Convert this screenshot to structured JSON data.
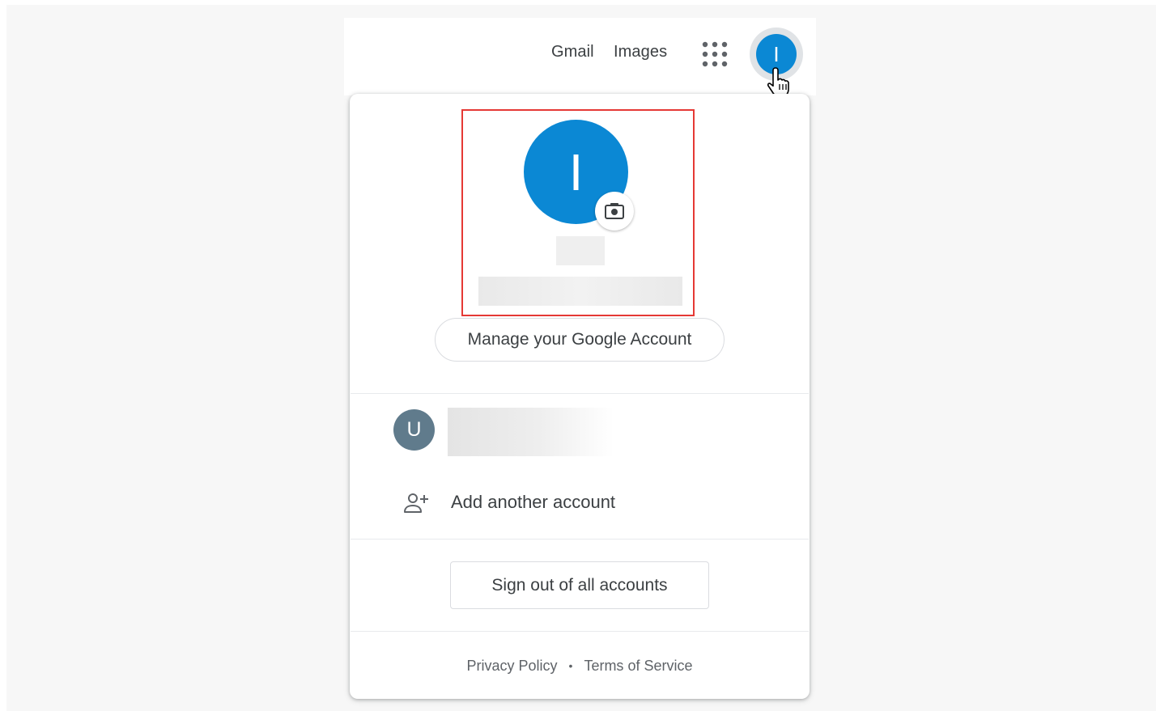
{
  "header": {
    "links": [
      {
        "label": "Gmail"
      },
      {
        "label": "Images"
      }
    ],
    "apps_icon": "apps-grid-icon",
    "avatar_initial": "I"
  },
  "account_panel": {
    "profile": {
      "avatar_initial": "I",
      "avatar_color": "#0b88d4",
      "camera_icon": "camera-icon"
    },
    "manage_button_label": "Manage your Google Account",
    "other_account": {
      "avatar_initial": "U",
      "avatar_color": "#607b8c"
    },
    "add_account_label": "Add another account",
    "sign_out_label": "Sign out of all accounts",
    "footer": {
      "privacy": "Privacy Policy",
      "separator": "•",
      "terms": "Terms of Service"
    }
  },
  "colors": {
    "highlight": "#e53935"
  }
}
